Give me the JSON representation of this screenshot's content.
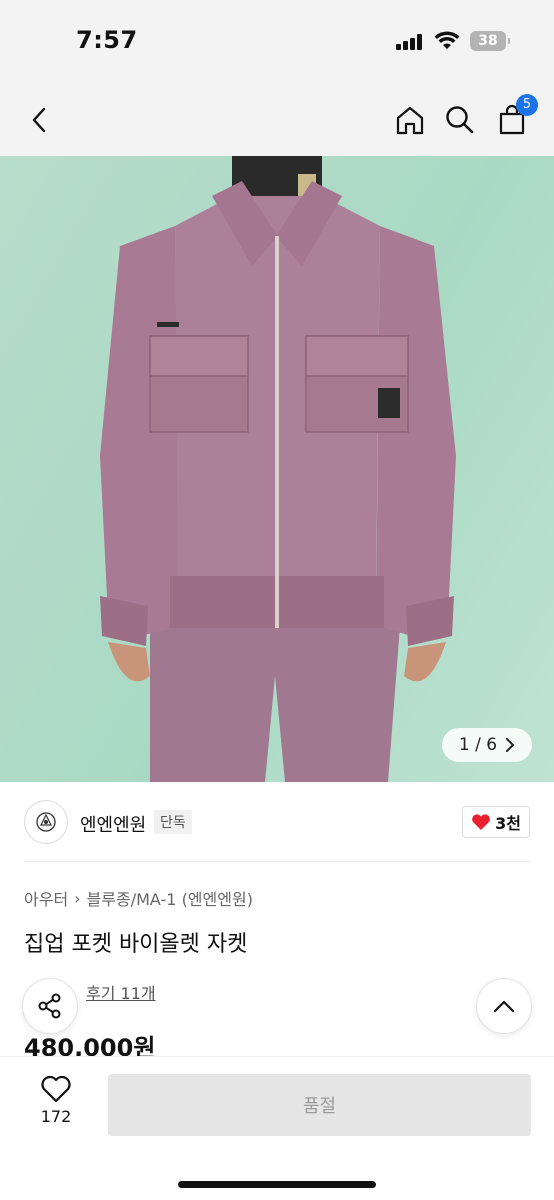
{
  "status": {
    "time": "7:57",
    "battery": "38"
  },
  "nav": {
    "cart_count": "5"
  },
  "gallery": {
    "counter": "1 / 6"
  },
  "brand": {
    "name": "엔엔엔원",
    "tag": "단독",
    "likes": "3천"
  },
  "breadcrumb": {
    "category": "아우터",
    "subcategory": "블루종/MA-1 (엔엔엔원)"
  },
  "product": {
    "title": "집업 포켓 바이올렛 자켓",
    "review_prefix": "★ 후기",
    "reviews": "후기 11개",
    "price": "480,000원"
  },
  "bottom": {
    "wish_count": "172",
    "soldout_label": "품절"
  },
  "colors": {
    "accent": "#1a73e8",
    "like_red": "#e8202f",
    "jacket": "#a87a93",
    "backdrop": "#b4dcc9"
  }
}
